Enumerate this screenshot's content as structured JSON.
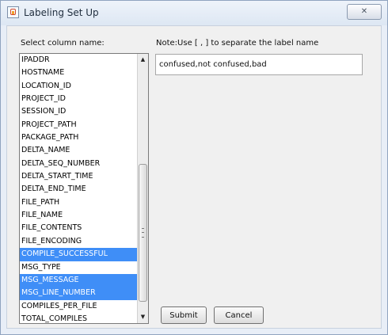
{
  "window": {
    "title": "Labeling Set Up",
    "close_symbol": "✕"
  },
  "panel": {
    "column_label": "Select column name:",
    "note": "Note:Use [ , ] to separate the label name"
  },
  "columns": {
    "items": [
      {
        "label": "IPADDR",
        "selected": false
      },
      {
        "label": "HOSTNAME",
        "selected": false
      },
      {
        "label": "LOCATION_ID",
        "selected": false
      },
      {
        "label": "PROJECT_ID",
        "selected": false
      },
      {
        "label": "SESSION_ID",
        "selected": false
      },
      {
        "label": "PROJECT_PATH",
        "selected": false
      },
      {
        "label": "PACKAGE_PATH",
        "selected": false
      },
      {
        "label": "DELTA_NAME",
        "selected": false
      },
      {
        "label": "DELTA_SEQ_NUMBER",
        "selected": false
      },
      {
        "label": "DELTA_START_TIME",
        "selected": false
      },
      {
        "label": "DELTA_END_TIME",
        "selected": false
      },
      {
        "label": "FILE_PATH",
        "selected": false
      },
      {
        "label": "FILE_NAME",
        "selected": false
      },
      {
        "label": "FILE_CONTENTS",
        "selected": false
      },
      {
        "label": "FILE_ENCODING",
        "selected": false
      },
      {
        "label": "COMPILE_SUCCESSFUL",
        "selected": true
      },
      {
        "label": "MSG_TYPE",
        "selected": false
      },
      {
        "label": "MSG_MESSAGE",
        "selected": true
      },
      {
        "label": "MSG_LINE_NUMBER",
        "selected": true
      },
      {
        "label": "COMPILES_PER_FILE",
        "selected": false
      },
      {
        "label": "TOTAL_COMPILES",
        "selected": false
      }
    ],
    "scroll_up": "▲",
    "scroll_down": "▼"
  },
  "labels_input": {
    "value": "confused,not confused,bad"
  },
  "buttons": {
    "submit": "Submit",
    "cancel": "Cancel"
  },
  "colors": {
    "selection": "#3f8ef7",
    "selection_text": "#ffffff"
  },
  "icons": {
    "window": "java-cup-icon",
    "close": "close-icon"
  }
}
